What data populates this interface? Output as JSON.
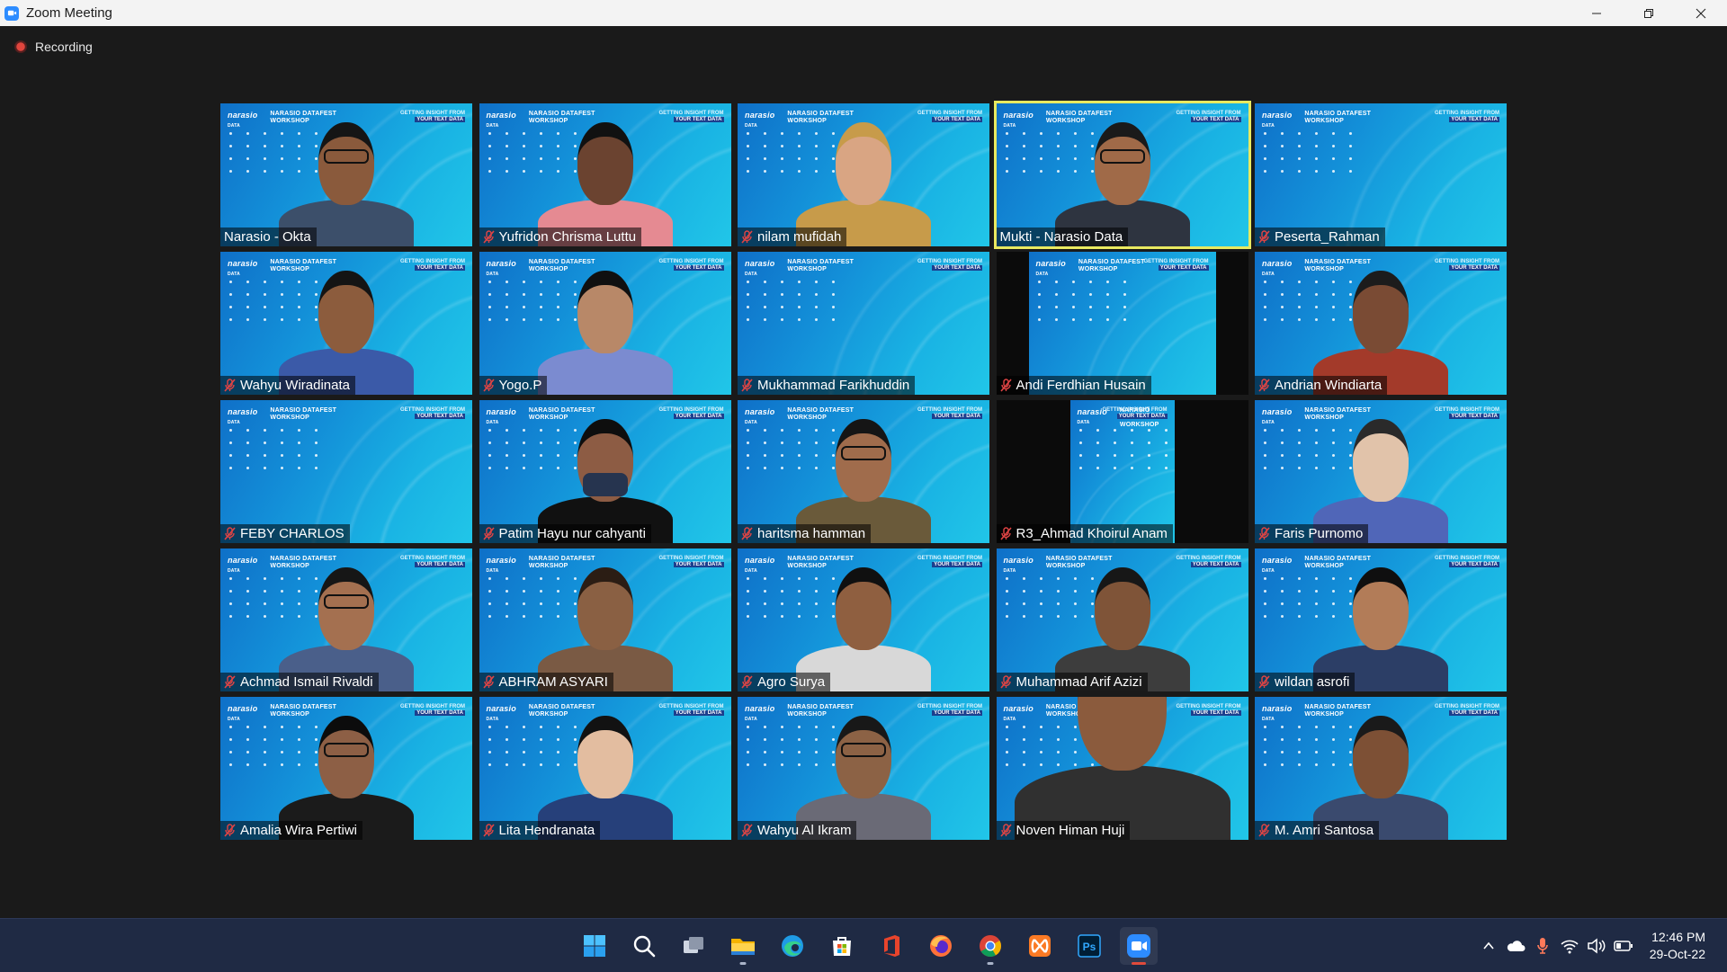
{
  "window": {
    "title": "Zoom Meeting"
  },
  "recording": {
    "label": "Recording"
  },
  "participants": [
    {
      "name": "Narasio - Okta",
      "muted": false,
      "video": true,
      "skin": "#8a5a3c",
      "hair": "#151515",
      "shirt": "#3c4f6a",
      "glasses": true
    },
    {
      "name": "Yufridon Chrisma Luttu",
      "muted": true,
      "video": true,
      "skin": "#6b4330",
      "hair": "#111",
      "shirt": "#e58a92",
      "glasses": false
    },
    {
      "name": "nilam mufidah",
      "muted": true,
      "video": true,
      "skin": "#d9a583",
      "hair": "#c79b4a",
      "shirt": "#c79b4a",
      "glasses": false
    },
    {
      "name": "Mukti - Narasio Data",
      "muted": false,
      "video": true,
      "skin": "#a06a48",
      "hair": "#1a1a1a",
      "shirt": "#2e3440",
      "glasses": true,
      "active": true
    },
    {
      "name": "Peserta_Rahman",
      "muted": true,
      "video": false
    },
    {
      "name": "Wahyu Wiradinata",
      "muted": true,
      "video": true,
      "skin": "#8c5c3d",
      "hair": "#141414",
      "shirt": "#3b5aa8",
      "glasses": false
    },
    {
      "name": "Yogo.P",
      "muted": true,
      "video": true,
      "skin": "#b88868",
      "hair": "#101010",
      "shirt": "#7b8bd0",
      "glasses": false
    },
    {
      "name": "Mukhammad Farikhuddin",
      "muted": true,
      "video": false
    },
    {
      "name": "Andi Ferdhian Husain",
      "muted": true,
      "video": false,
      "narrow": "narrow"
    },
    {
      "name": "Andrian Windiarta",
      "muted": true,
      "video": true,
      "skin": "#7a4b34",
      "hair": "#1c1c1c",
      "shirt": "#a33a2a",
      "glasses": false
    },
    {
      "name": "FEBY CHARLOS",
      "muted": true,
      "video": false
    },
    {
      "name": "Patim Hayu nur cahyanti",
      "muted": true,
      "video": true,
      "skin": "#8d5c44",
      "hair": "#0e0e0e",
      "shirt": "#111",
      "glasses": false,
      "mask": true
    },
    {
      "name": "haritsma hamman",
      "muted": true,
      "video": true,
      "skin": "#a06c4c",
      "hair": "#151515",
      "shirt": "#6a5a3a",
      "glasses": true
    },
    {
      "name": "R3_Ahmad Khoirul Anam",
      "muted": true,
      "video": false,
      "narrow": "narrower"
    },
    {
      "name": "Faris Purnomo",
      "muted": true,
      "video": true,
      "skin": "#e1c3aa",
      "hair": "#2a2a2a",
      "shirt": "#5066b8",
      "glasses": false
    },
    {
      "name": "Achmad Ismail Rivaldi",
      "muted": true,
      "video": true,
      "skin": "#a47050",
      "hair": "#161616",
      "shirt": "#4a5f8a",
      "glasses": true
    },
    {
      "name": "ABHRAM ASYARI",
      "muted": true,
      "video": true,
      "skin": "#8a6043",
      "hair": "#2b1d14",
      "shirt": "#7a5a44",
      "glasses": false
    },
    {
      "name": "Agro Surya",
      "muted": true,
      "video": true,
      "skin": "#8f5f40",
      "hair": "#101010",
      "shirt": "#d8d8d8",
      "glasses": false
    },
    {
      "name": "Muhammad Arif Azizi",
      "muted": true,
      "video": true,
      "skin": "#7f5438",
      "hair": "#171717",
      "shirt": "#3d3d3d",
      "glasses": false
    },
    {
      "name": "wildan asrofi",
      "muted": true,
      "video": true,
      "skin": "#b27c58",
      "hair": "#0f0f0f",
      "shirt": "#2c3e66",
      "glasses": false
    },
    {
      "name": "Amalia Wira Pertiwi",
      "muted": true,
      "video": true,
      "skin": "#8d5f45",
      "hair": "#0c0c0c",
      "shirt": "#1b1b1b",
      "glasses": true
    },
    {
      "name": "Lita Hendranata",
      "muted": true,
      "video": true,
      "skin": "#e3bda0",
      "hair": "#121212",
      "shirt": "#26407a",
      "glasses": false
    },
    {
      "name": "Wahyu Al Ikram",
      "muted": true,
      "video": true,
      "skin": "#8c6245",
      "hair": "#181818",
      "shirt": "#6a6a76",
      "glasses": true
    },
    {
      "name": "Noven Himan Huji",
      "muted": true,
      "video": true,
      "skin": "#8b5b3d",
      "hair": "#141414",
      "shirt": "#303030",
      "glasses": false,
      "big": true
    },
    {
      "name": "M. Amri Santosa",
      "muted": true,
      "video": true,
      "skin": "#7d5035",
      "hair": "#1a1a1a",
      "shirt": "#3a4a6e",
      "glasses": false
    }
  ],
  "background": {
    "logo": "narasio",
    "logo_sub": "DATA",
    "event_line1": "NARASIO DATAFEST",
    "event_line2": "WORKSHOP",
    "tagline_line1": "GETTING INSIGHT FROM",
    "tagline_line2": "YOUR TEXT DATA"
  },
  "taskbar": {
    "apps": [
      {
        "name": "start-icon",
        "open": false
      },
      {
        "name": "search-icon",
        "open": false
      },
      {
        "name": "task-view-icon",
        "open": false
      },
      {
        "name": "file-explorer-icon",
        "open": true
      },
      {
        "name": "edge-icon",
        "open": false
      },
      {
        "name": "microsoft-store-icon",
        "open": false
      },
      {
        "name": "office-icon",
        "open": false
      },
      {
        "name": "firefox-icon",
        "open": false
      },
      {
        "name": "chrome-icon",
        "open": true
      },
      {
        "name": "xampp-icon",
        "open": false
      },
      {
        "name": "photoshop-icon",
        "open": false
      },
      {
        "name": "zoom-icon",
        "open": true,
        "focused": true
      }
    ],
    "photoshop_label": "Ps",
    "time": "12:46 PM",
    "date": "29-Oct-22"
  }
}
